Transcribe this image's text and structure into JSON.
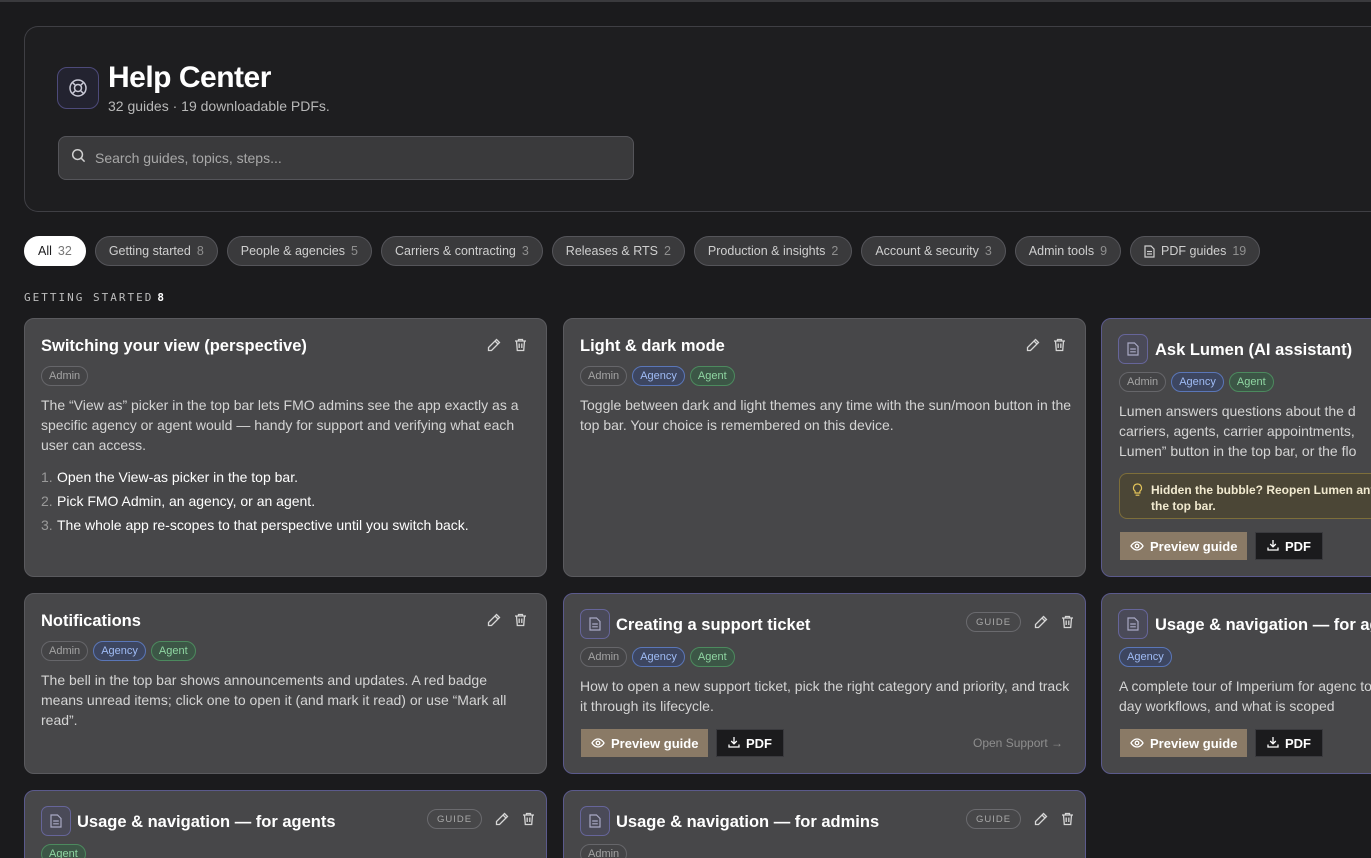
{
  "header": {
    "title": "Help Center",
    "subtitle": "32 guides · 19 downloadable PDFs.",
    "search_placeholder": "Search guides, topics, steps..."
  },
  "filters": [
    {
      "label": "All",
      "count": "32",
      "active": true
    },
    {
      "label": "Getting started",
      "count": "8"
    },
    {
      "label": "People & agencies",
      "count": "5"
    },
    {
      "label": "Carriers & contracting",
      "count": "3"
    },
    {
      "label": "Releases & RTS",
      "count": "2"
    },
    {
      "label": "Production & insights",
      "count": "2"
    },
    {
      "label": "Account & security",
      "count": "3"
    },
    {
      "label": "Admin tools",
      "count": "9"
    },
    {
      "label": "PDF guides",
      "count": "19"
    }
  ],
  "section": {
    "label": "GETTING STARTED",
    "count": "8"
  },
  "common": {
    "guide_badge": "GUIDE",
    "preview_label": "Preview guide",
    "pdf_label": "PDF",
    "tag_admin": "Admin",
    "tag_agency": "Agency",
    "tag_agent": "Agent"
  },
  "cards": {
    "perspective": {
      "title": "Switching your view (perspective)",
      "desc": "The “View as” picker in the top bar lets FMO admins see the app exactly as a specific agency or agent would — handy for support and verifying what each user can access.",
      "steps": [
        {
          "n": "1.",
          "text": "Open the View-as picker in the top bar."
        },
        {
          "n": "2.",
          "text": "Pick FMO Admin, an agency, or an agent."
        },
        {
          "n": "3.",
          "text": "The whole app re-scopes to that perspective until you switch back."
        }
      ]
    },
    "theme": {
      "title": "Light & dark mode",
      "desc": "Toggle between dark and light themes any time with the sun/moon button in the top bar. Your choice is remembered on this device."
    },
    "lumen": {
      "title": "Ask Lumen (AI assistant)",
      "desc": "Lumen answers questions about the d carriers, agents, carrier appointments, Lumen” button in the top bar, or the flo",
      "tip": "Hidden the bubble? Reopen Lumen any the top bar."
    },
    "notifications": {
      "title": "Notifications",
      "desc": "The bell in the top bar shows announcements and updates. A red badge means unread items; click one to open it (and mark it read) or use “Mark all read”."
    },
    "ticket": {
      "title": "Creating a support ticket",
      "desc": "How to open a new support ticket, pick the right category and priority, and track it through its lifecycle.",
      "link": "Open Support →"
    },
    "usage_agencies": {
      "title": "Usage & navigation — for ag",
      "desc": "A complete tour of Imperium for agenc to-day workflows, and what is scoped"
    },
    "usage_agents": {
      "title": "Usage & navigation — for agents"
    },
    "usage_admins": {
      "title": "Usage & navigation — for admins"
    }
  }
}
